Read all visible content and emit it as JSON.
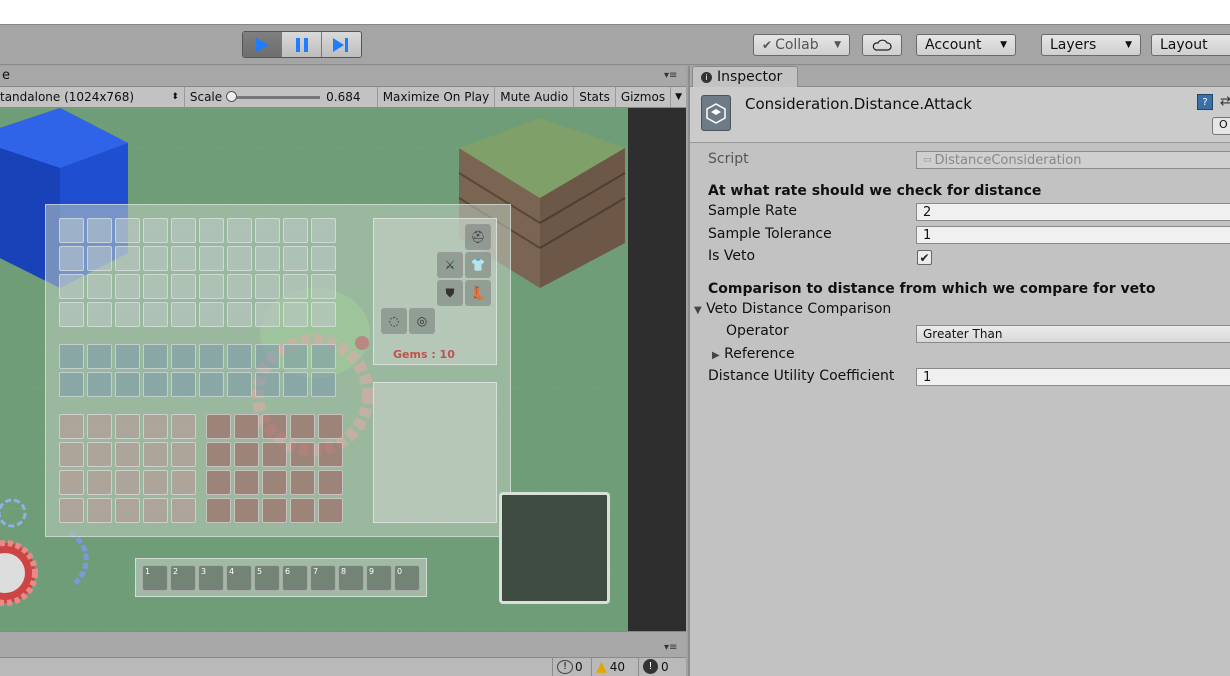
{
  "toolbar": {
    "collab_label": "Collab",
    "account_label": "Account",
    "layers_label": "Layers",
    "layout_label": "Layout"
  },
  "game": {
    "tab_label": "e",
    "resolution": "tandalone (1024x768)",
    "scale_label": "Scale",
    "scale_value": "0.684",
    "maximize_label": "Maximize On Play",
    "mute_label": "Mute Audio",
    "stats_label": "Stats",
    "gizmos_label": "Gizmos",
    "gems_text": "Gems : 10",
    "hotbar_numbers": [
      "1",
      "2",
      "3",
      "4",
      "5",
      "6",
      "7",
      "8",
      "9",
      "0"
    ]
  },
  "status": {
    "info_count": "0",
    "warning_count": "40",
    "error_count": "0"
  },
  "inspector": {
    "tab_label": "Inspector",
    "object_title": "Consideration.Distance.Attack",
    "open_label": "O",
    "script_label": "Script",
    "script_value": "DistanceConsideration",
    "section1": "At what rate should we check for distance",
    "sample_rate_label": "Sample Rate",
    "sample_rate_value": "2",
    "sample_tolerance_label": "Sample Tolerance",
    "sample_tolerance_value": "1",
    "is_veto_label": "Is Veto",
    "is_veto_checked": true,
    "section2": "Comparison to distance from which we compare for veto",
    "veto_comparison_label": "Veto Distance Comparison",
    "operator_label": "Operator",
    "operator_value": "Greater Than",
    "reference_label": "Reference",
    "coefficient_label": "Distance Utility Coefficient",
    "coefficient_value": "1"
  }
}
